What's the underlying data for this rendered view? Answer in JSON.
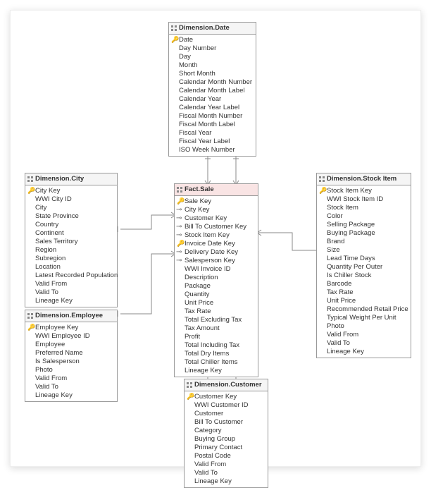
{
  "tables": {
    "dim_date": {
      "title": "Dimension.Date",
      "columns": [
        {
          "name": "Date",
          "key": true
        },
        {
          "name": "Day Number"
        },
        {
          "name": "Day"
        },
        {
          "name": "Month"
        },
        {
          "name": "Short Month"
        },
        {
          "name": "Calendar Month Number"
        },
        {
          "name": "Calendar Month Label"
        },
        {
          "name": "Calendar Year"
        },
        {
          "name": "Calendar Year Label"
        },
        {
          "name": "Fiscal Month Number"
        },
        {
          "name": "Fiscal Month Label"
        },
        {
          "name": "Fiscal Year"
        },
        {
          "name": "Fiscal Year Label"
        },
        {
          "name": "ISO Week Number"
        }
      ]
    },
    "dim_city": {
      "title": "Dimension.City",
      "columns": [
        {
          "name": "City Key",
          "key": true
        },
        {
          "name": "WWI City ID"
        },
        {
          "name": "City"
        },
        {
          "name": "State Province"
        },
        {
          "name": "Country"
        },
        {
          "name": "Continent"
        },
        {
          "name": "Sales Territory"
        },
        {
          "name": "Region"
        },
        {
          "name": "Subregion"
        },
        {
          "name": "Location"
        },
        {
          "name": "Latest Recorded Population"
        },
        {
          "name": "Valid From"
        },
        {
          "name": "Valid To"
        },
        {
          "name": "Lineage Key"
        }
      ]
    },
    "fact_sale": {
      "title": "Fact.Sale",
      "columns": [
        {
          "name": "Sale Key",
          "key": true
        },
        {
          "name": "City Key",
          "fk": true
        },
        {
          "name": "Customer Key",
          "fk": true
        },
        {
          "name": "Bill To Customer Key",
          "fk": true
        },
        {
          "name": "Stock Item Key",
          "fk": true
        },
        {
          "name": "Invoice Date Key",
          "key": true
        },
        {
          "name": "Delivery Date Key",
          "fk": true
        },
        {
          "name": "Salesperson Key",
          "fk": true
        },
        {
          "name": "WWI Invoice ID"
        },
        {
          "name": "Description"
        },
        {
          "name": "Package"
        },
        {
          "name": "Quantity"
        },
        {
          "name": "Unit Price"
        },
        {
          "name": "Tax Rate"
        },
        {
          "name": "Total Excluding Tax"
        },
        {
          "name": "Tax Amount"
        },
        {
          "name": "Profit"
        },
        {
          "name": "Total Including Tax"
        },
        {
          "name": "Total Dry Items"
        },
        {
          "name": "Total Chiller Items"
        },
        {
          "name": "Lineage Key"
        }
      ]
    },
    "dim_stock": {
      "title": "Dimension.Stock Item",
      "columns": [
        {
          "name": "Stock Item Key",
          "key": true
        },
        {
          "name": "WWI Stock Item ID"
        },
        {
          "name": "Stock Item"
        },
        {
          "name": "Color"
        },
        {
          "name": "Selling Package"
        },
        {
          "name": "Buying Package"
        },
        {
          "name": "Brand"
        },
        {
          "name": "Size"
        },
        {
          "name": "Lead Time Days"
        },
        {
          "name": "Quantity Per Outer"
        },
        {
          "name": "Is Chiller Stock"
        },
        {
          "name": "Barcode"
        },
        {
          "name": "Tax Rate"
        },
        {
          "name": "Unit Price"
        },
        {
          "name": "Recommended Retail Price"
        },
        {
          "name": "Typical Weight Per Unit"
        },
        {
          "name": "Photo"
        },
        {
          "name": "Valid From"
        },
        {
          "name": "Valid To"
        },
        {
          "name": "Lineage Key"
        }
      ]
    },
    "dim_employee": {
      "title": "Dimension.Employee",
      "columns": [
        {
          "name": "Employee Key",
          "key": true
        },
        {
          "name": "WWI Employee ID"
        },
        {
          "name": "Employee"
        },
        {
          "name": "Preferred Name"
        },
        {
          "name": "Is Salesperson"
        },
        {
          "name": "Photo"
        },
        {
          "name": "Valid From"
        },
        {
          "name": "Valid To"
        },
        {
          "name": "Lineage Key"
        }
      ]
    },
    "dim_customer": {
      "title": "Dimension.Customer",
      "columns": [
        {
          "name": "Customer Key",
          "key": true
        },
        {
          "name": "WWI Customer ID"
        },
        {
          "name": "Customer"
        },
        {
          "name": "Bill To Customer"
        },
        {
          "name": "Category"
        },
        {
          "name": "Buying Group"
        },
        {
          "name": "Primary Contact"
        },
        {
          "name": "Postal Code"
        },
        {
          "name": "Valid From"
        },
        {
          "name": "Valid To"
        },
        {
          "name": "Lineage Key"
        }
      ]
    }
  }
}
